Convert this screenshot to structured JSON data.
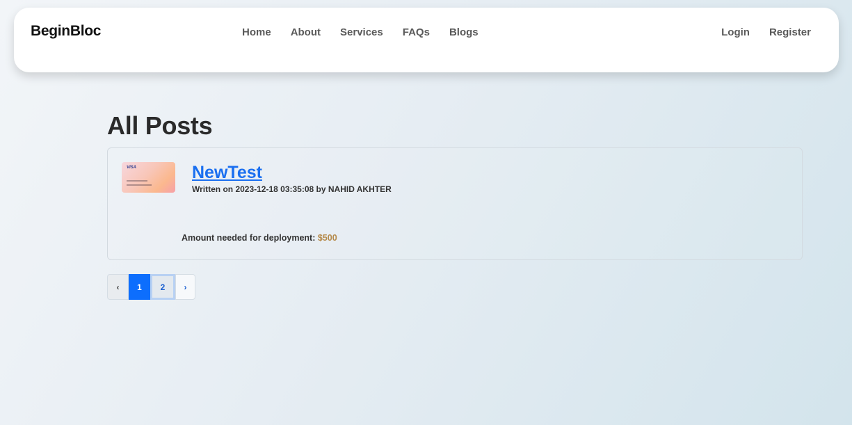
{
  "nav": {
    "brand": "BeginBloc",
    "links": [
      "Home",
      "About",
      "Services",
      "FAQs",
      "Blogs"
    ],
    "auth": [
      "Login",
      "Register"
    ]
  },
  "page": {
    "title": "All Posts"
  },
  "posts": [
    {
      "title": "NewTest",
      "meta": "Written on 2023-12-18 03:35:08 by NAHID AKHTER",
      "amount_label": "Amount needed for deployment:",
      "amount_value": "$500",
      "thumb_brand": "VISA"
    }
  ],
  "pagination": {
    "prev": "‹",
    "pages": [
      "1",
      "2"
    ],
    "next": "›",
    "current": "1"
  },
  "colors": {
    "accent": "#0d6efd",
    "link": "#1a6ff0",
    "amount": "#b58a4a"
  }
}
